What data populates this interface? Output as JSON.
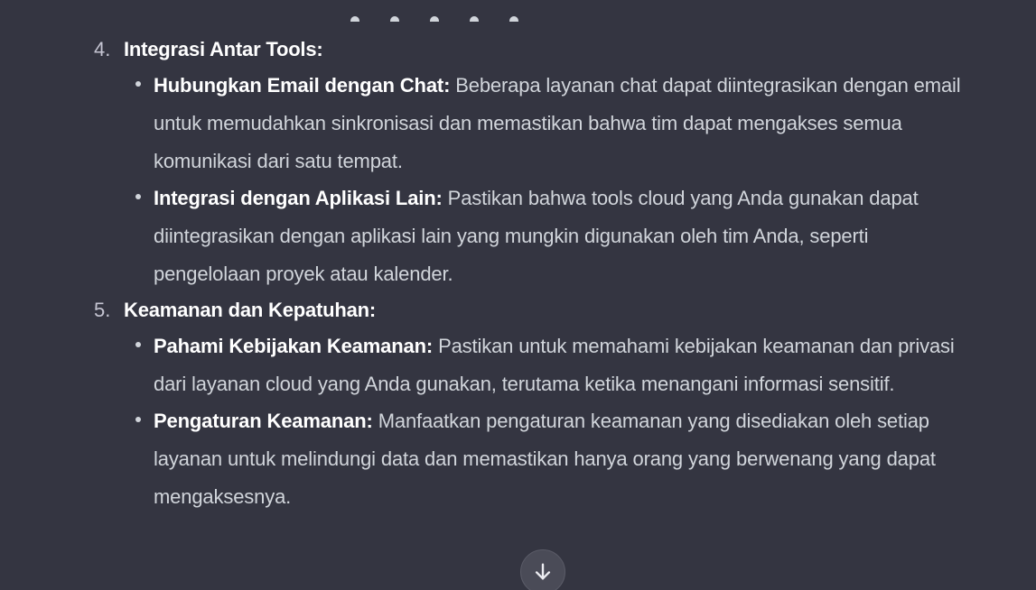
{
  "steps": [
    {
      "number": "4.",
      "title": "Integrasi Antar Tools:",
      "bullets": [
        {
          "term": "Hubungkan Email dengan Chat:",
          "text": " Beberapa layanan chat dapat diintegrasikan dengan email untuk memudahkan sinkronisasi dan memastikan bahwa tim dapat mengakses semua komunikasi dari satu tempat."
        },
        {
          "term": "Integrasi dengan Aplikasi Lain:",
          "text": " Pastikan bahwa tools cloud yang Anda gunakan dapat diintegrasikan dengan aplikasi lain yang mungkin digunakan oleh tim Anda, seperti pengelolaan proyek atau kalender."
        }
      ]
    },
    {
      "number": "5.",
      "title": "Keamanan dan Kepatuhan:",
      "bullets": [
        {
          "term": "Pahami Kebijakan Keamanan:",
          "text": " Pastikan untuk memahami kebijakan keamanan dan privasi dari layanan cloud yang Anda gunakan, terutama ketika menangani informasi sensitif."
        },
        {
          "term": "Pengaturan Keamanan:",
          "text": " Manfaatkan pengaturan keamanan yang disediakan oleh setiap layanan untuk melindungi data dan memastikan hanya orang yang berwenang yang dapat mengaksesnya."
        }
      ]
    }
  ],
  "scroll_button": {
    "icon": "arrow-down-icon"
  },
  "colors": {
    "background": "#343541",
    "heading_text": "#ffffff",
    "body_text": "#d1d5db",
    "scroll_button_bg": "#4a4b57"
  }
}
